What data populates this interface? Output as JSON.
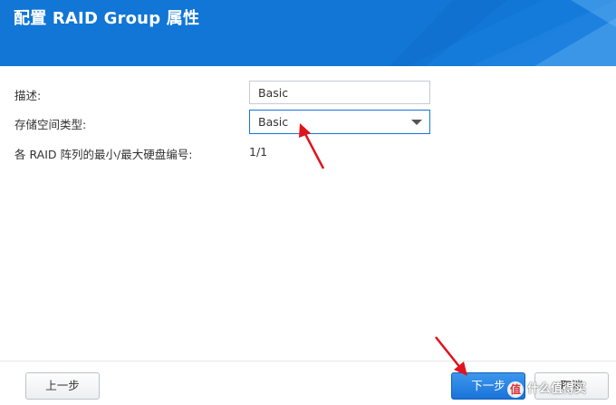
{
  "dialog": {
    "title": "配置 RAID Group 属性"
  },
  "form": {
    "description_label": "描述:",
    "description_value": "Basic",
    "storage_type_label": "存储空间类型:",
    "storage_type_selected": "Basic",
    "min_max_disks_label": "各 RAID 阵列的最小/最大硬盘编号:",
    "min_max_disks_value": "1/1"
  },
  "footer": {
    "prev_label": "上一步",
    "next_label": "下一步",
    "cancel_label": "取消"
  },
  "watermark": {
    "text": "什么值得买"
  },
  "colors": {
    "header_blue": "#1176d6",
    "accent_blue": "#1a73d9",
    "annotation_red": "#e0141e"
  },
  "icons": {
    "dropdown": "chevron-down-icon",
    "annotation": "red-arrow"
  }
}
